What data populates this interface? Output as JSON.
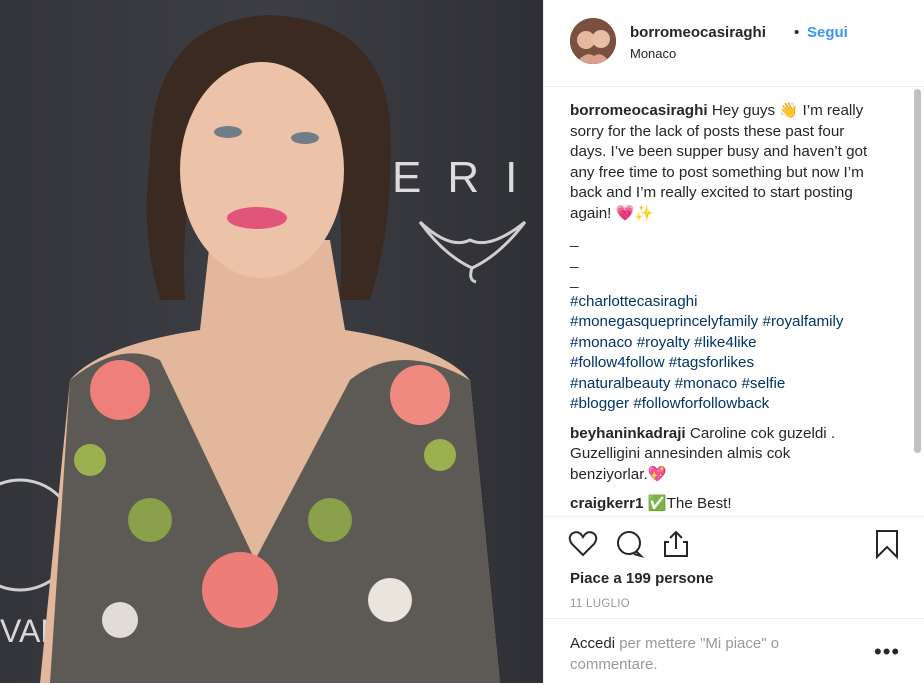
{
  "post": {
    "username": "borromeocasiraghi",
    "separator": "•",
    "follow_label": "Segui",
    "location": "Monaco",
    "photo_text": {
      "brand_letters": "ERI",
      "bottom_left": "VAL"
    }
  },
  "caption": {
    "username": "borromeocasiraghi",
    "text": "Hey guys 👋 I’m really sorry for the lack of posts these past four days. I’ve been supper busy and haven’t got any free time to post something but now I’m back and I’m really excited to start posting again! 💗✨",
    "dashes": [
      "_",
      "_",
      "_"
    ],
    "tags": [
      "#charlottecasiraghi",
      "#monegasqueprincelyfamily",
      "#royalfamily",
      "#monaco",
      "#royalty",
      "#like4like",
      "#follow4follow",
      "#tagsforlikes",
      "#naturalbeauty",
      "#monaco",
      "#selfie",
      "#blogger",
      "#followforfollowback"
    ]
  },
  "comments": [
    {
      "username": "beyhaninkadraji",
      "text": "Caroline cok guzeldi . Guzelligini annesinden almis cok benziyorlar.💖"
    },
    {
      "username": "craigkerr1",
      "text": "✅The Best!"
    }
  ],
  "actions": {
    "like_icon": "heart-icon",
    "comment_icon": "comment-icon",
    "share_icon": "share-icon",
    "save_icon": "bookmark-icon",
    "likes_text": "Piace a 199 persone",
    "date": "11 LUGLIO",
    "login_link": "Accedi",
    "login_suffix": " per mettere \"Mi piace\" o commentare.",
    "more": "•••"
  },
  "colors": {
    "link": "#003569",
    "follow": "#3897f0",
    "muted": "#999999",
    "border": "#efefef"
  }
}
